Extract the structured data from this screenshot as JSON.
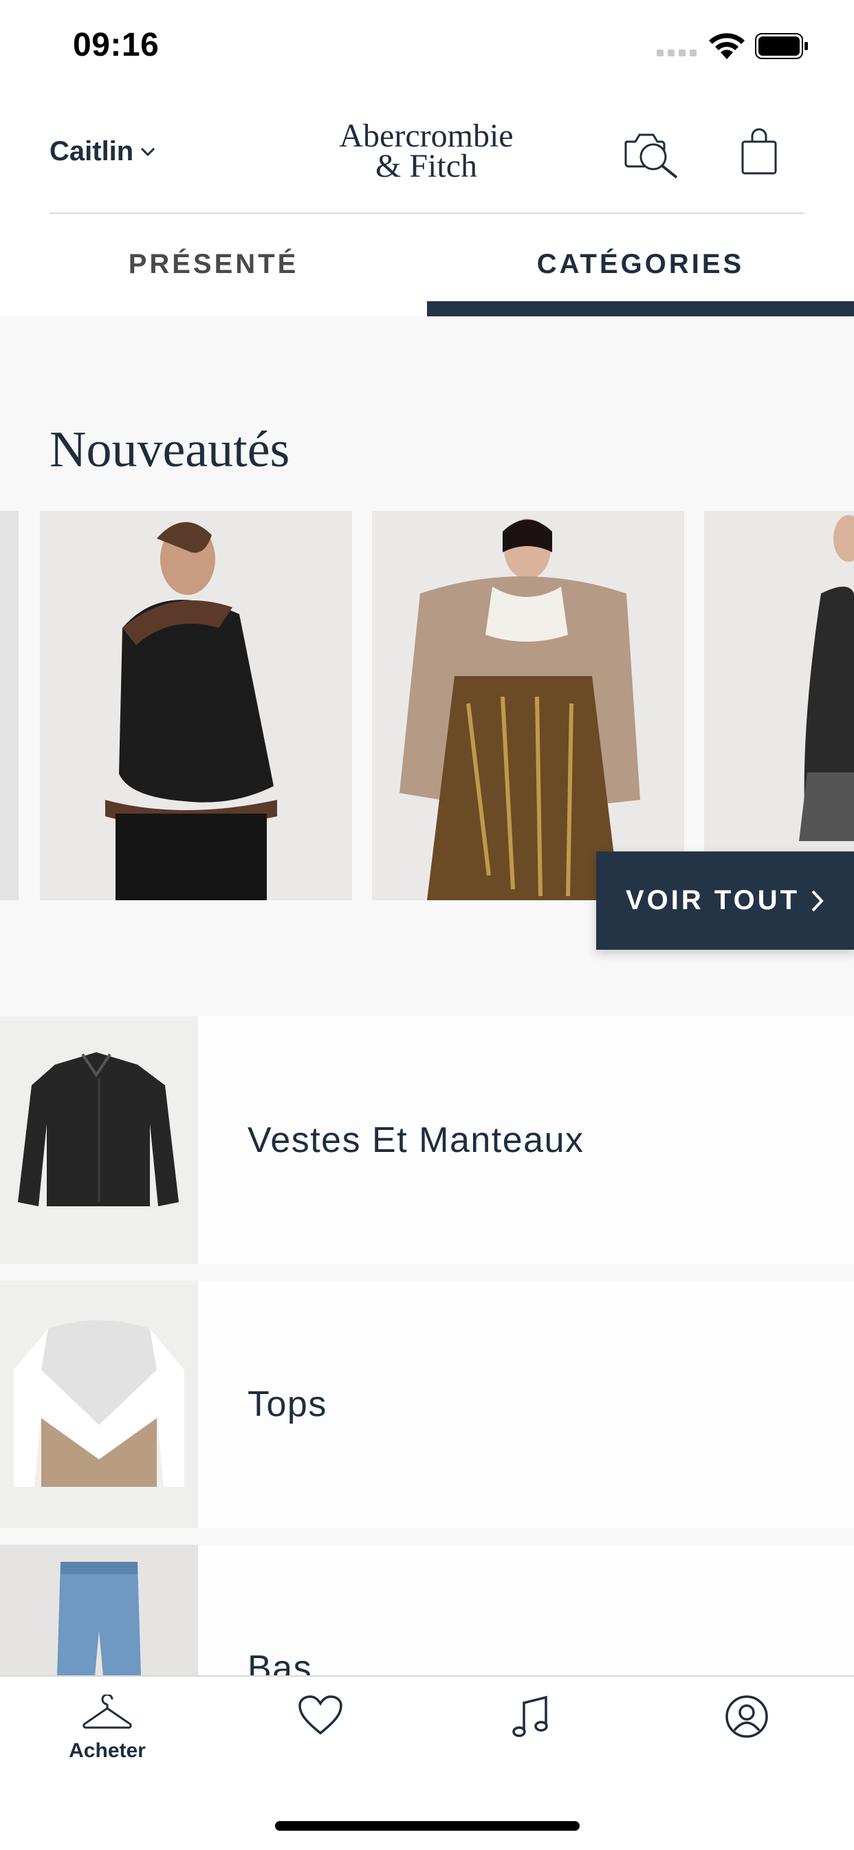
{
  "status_bar": {
    "time": "09:16"
  },
  "header": {
    "user_name": "Caitlin",
    "logo_line1": "Abercrombie",
    "logo_line2": "& Fitch",
    "icons": [
      "camera-search-icon",
      "shopping-bag-icon",
      "chevron-down-icon"
    ]
  },
  "tabs": [
    {
      "label": "PRÉSENTÉ",
      "active": false
    },
    {
      "label": "CATÉGORIES",
      "active": true
    }
  ],
  "new_arrivals": {
    "title": "Nouveautés",
    "products": [
      "partial-product-image",
      "black-shearling-jacket-model",
      "tan-shearling-jacket-floral-skirt-model",
      "partial-black-dress-model"
    ],
    "see_all_label": "VOIR TOUT"
  },
  "categories": [
    {
      "label": "Vestes Et Manteaux",
      "thumb": "black-denim-jacket"
    },
    {
      "label": "Tops",
      "thumb": "colorblock-sweatshirt"
    },
    {
      "label": "Bas",
      "thumb": "light-wash-jeans"
    }
  ],
  "bottom_nav": [
    {
      "label": "Acheter",
      "icon": "hanger-icon",
      "active": true
    },
    {
      "label": "",
      "icon": "heart-icon"
    },
    {
      "label": "",
      "icon": "music-note-icon"
    },
    {
      "label": "",
      "icon": "account-icon"
    }
  ],
  "colors": {
    "navy": "#243447",
    "text": "#1f2d3d",
    "background": "#f8f8f8"
  }
}
